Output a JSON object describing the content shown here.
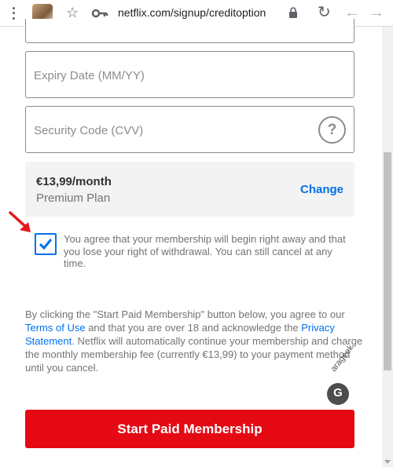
{
  "browser": {
    "url": "netflix.com/signup/creditoption",
    "icons": [
      "menu-dots-icon",
      "profile-avatar",
      "star-icon",
      "key-icon",
      "lock-icon",
      "reload-icon",
      "back-icon",
      "forward-icon"
    ]
  },
  "form": {
    "expiry_placeholder": "Expiry Date (MM/YY)",
    "cvv_placeholder": "Security Code (CVV)",
    "cvv_help": "?"
  },
  "plan": {
    "price": "€13,99/month",
    "name": "Premium Plan",
    "change_label": "Change"
  },
  "agreement": {
    "checked": true,
    "text": "You agree that your membership will begin right away and that you lose your right of withdrawal. You can still cancel at any time."
  },
  "legal": {
    "part1": "By clicking the \"Start Paid Membership\" button below, you agree to our ",
    "terms_link": "Terms of Use",
    "part2": " and that you are over 18 and acknowledge the ",
    "privacy_link": "Privacy Statement",
    "part3": ". Netflix will automatically continue your membership and charge the monthly membership fee (currently €13,99) to your payment method until you cancel."
  },
  "watermark": {
    "text": "arageek",
    "logo": "G"
  },
  "submit_label": "Start Paid Membership",
  "colors": {
    "accent_blue": "#0071eb",
    "netflix_red": "#e50914",
    "annotation_arrow": "#e8141c"
  }
}
